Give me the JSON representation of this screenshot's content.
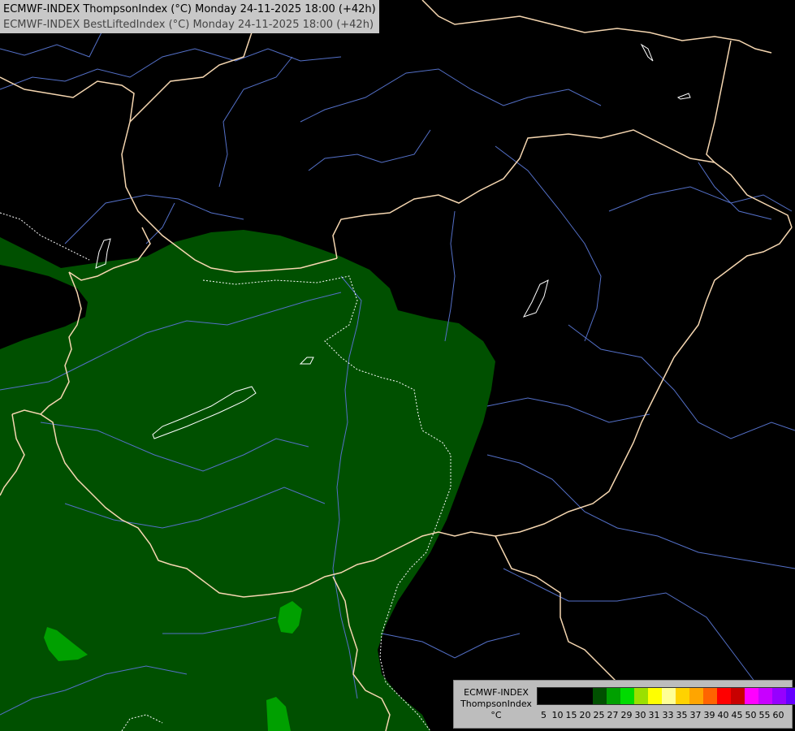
{
  "header": {
    "line1": "ECMWF-INDEX ThompsonIndex (°C) Monday 24-11-2025 18:00 (+42h)",
    "line2": "ECMWF-INDEX BestLiftedIndex (°C) Monday 24-11-2025 18:00 (+42h)"
  },
  "map_style": {
    "background": "#000000",
    "fill_main": "#005000",
    "fill_highlight": "#00a000",
    "country_border": "#f5d6b0",
    "river": "#5470c8",
    "contour": "#ffffff"
  },
  "legend": {
    "line1": "ECMWF-INDEX",
    "line2": "ThompsonIndex",
    "line3": "°C",
    "colors": [
      "#000000",
      "#000000",
      "#000000",
      "#000000",
      "#005000",
      "#00a000",
      "#00dc00",
      "#9be000",
      "#ffff00",
      "#ffff96",
      "#ffd200",
      "#ffa500",
      "#ff6400",
      "#ff0000",
      "#c80000",
      "#ff00ff",
      "#c800ff",
      "#9600ff",
      "#6400ff",
      "#0000ff"
    ],
    "ticks": [
      "5",
      "10",
      "15",
      "20",
      "25",
      "27",
      "29",
      "30",
      "31",
      "33",
      "35",
      "37",
      "39",
      "40",
      "45",
      "50",
      "55",
      "60"
    ]
  }
}
